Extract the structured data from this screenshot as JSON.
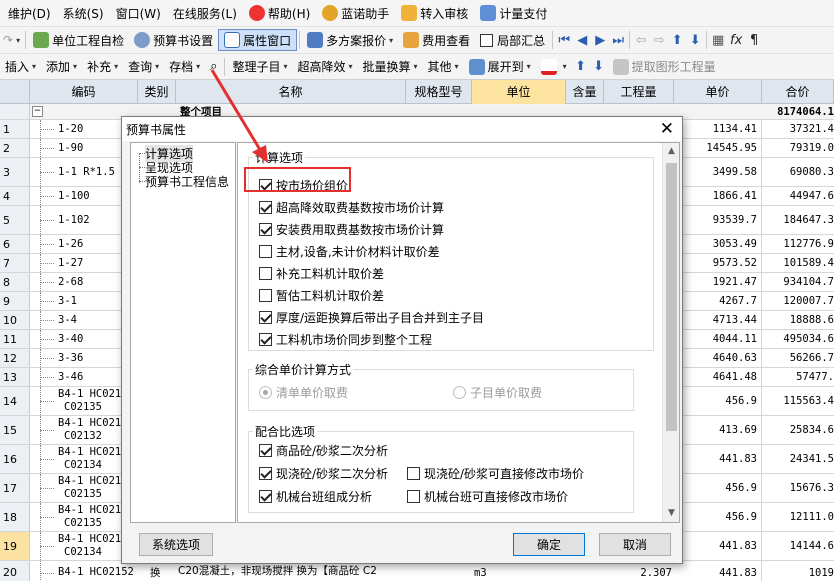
{
  "menubar": {
    "items": [
      "维护(D)",
      "系统(S)",
      "窗口(W)",
      "在线服务(L)",
      "帮助(H)",
      "蓝诺助手",
      "转入审核",
      "计量支付"
    ]
  },
  "toolbar1": {
    "items": [
      "单位工程自检",
      "预算书设置",
      "属性窗口",
      "多方案报价",
      "费用查看",
      "局部汇总"
    ]
  },
  "toolbar2": {
    "items": [
      "插入",
      "添加",
      "补充",
      "查询",
      "存档",
      "整理子目",
      "超高降效",
      "批量换算",
      "其他",
      "展开到",
      "提取图形工程量"
    ]
  },
  "grid": {
    "headers": [
      "编码",
      "类别",
      "名称",
      "规格型号",
      "单位",
      "含量",
      "工程量",
      "单价",
      "合价"
    ],
    "top_row": {
      "name": "整个项目",
      "total": "8174064.1"
    },
    "rows": [
      {
        "no": "1",
        "code": "1-20",
        "price": "1134.41",
        "total": "37321.4"
      },
      {
        "no": "2",
        "code": "1-90",
        "price": "14545.95",
        "total": "79319.0"
      },
      {
        "no": "3",
        "code": "1-1 R*1.5",
        "price": "3499.58",
        "total": "69080.3"
      },
      {
        "no": "4",
        "code": "1-100",
        "price": "1866.41",
        "total": "44947.6"
      },
      {
        "no": "5",
        "code": "1-102",
        "price": "93539.7",
        "total": "184647.3"
      },
      {
        "no": "6",
        "code": "1-26",
        "price": "3053.49",
        "total": "112776.9"
      },
      {
        "no": "7",
        "code": "1-27",
        "price": "9573.52",
        "total": "101589.4"
      },
      {
        "no": "8",
        "code": "2-68",
        "price": "1921.47",
        "total": "934104.7"
      },
      {
        "no": "9",
        "code": "3-1",
        "price": "4267.7",
        "total": "120007.7"
      },
      {
        "no": "10",
        "code": "3-4",
        "price": "4713.44",
        "total": "18888.6"
      },
      {
        "no": "11",
        "code": "3-40",
        "price": "4044.11",
        "total": "495034.6"
      },
      {
        "no": "12",
        "code": "3-36",
        "price": "4640.63",
        "total": "56266.7"
      },
      {
        "no": "13",
        "code": "3-46",
        "price": "4641.48",
        "total": "57477."
      },
      {
        "no": "14",
        "code": "B4-1 HC0215",
        "code2": "C02135",
        "price": "456.9",
        "total": "115563.4"
      },
      {
        "no": "15",
        "code": "B4-1 HC0215",
        "code2": "C02132",
        "price": "413.69",
        "total": "25834.6"
      },
      {
        "no": "16",
        "code": "B4-1 HC0215",
        "code2": "C02134",
        "price": "441.83",
        "total": "24341.5"
      },
      {
        "no": "17",
        "code": "B4-1 HC0215",
        "code2": "C02135",
        "price": "456.9",
        "total": "15676.3"
      },
      {
        "no": "18",
        "code": "B4-1 HC0215",
        "code2": "C02135",
        "price": "456.9",
        "total": "12111.0"
      },
      {
        "no": "19",
        "code": "B4-1 HC0215",
        "code2": "C02134",
        "price": "441.83",
        "total": "14144.6"
      },
      {
        "no": "20",
        "code": "B4-1 HC02152",
        "type": "换",
        "name": "C20混凝土，非现场搅拌 换为【商品砼 C2",
        "unit": "m3",
        "qty": "2.307",
        "price": "441.83",
        "total": "1019"
      }
    ]
  },
  "dialog": {
    "title": "预算书属性",
    "tree": [
      "计算选项",
      "呈现选项",
      "预算书工程信息"
    ],
    "group1": {
      "label": "计算选项",
      "options": [
        {
          "label": "按市场价组价",
          "checked": true
        },
        {
          "label": "超高降效取费基数按市场价计算",
          "checked": true
        },
        {
          "label": "安装费用取费基数按市场价计算",
          "checked": true
        },
        {
          "label": "主材,设备,未计价材料计取价差",
          "checked": false
        },
        {
          "label": "补充工料机计取价差",
          "checked": false
        },
        {
          "label": "暂估工料机计取价差",
          "checked": false
        },
        {
          "label": "厚度/运距换算后带出子目合并到主子目",
          "checked": true
        },
        {
          "label": "工料机市场价同步到整个工程",
          "checked": true
        }
      ]
    },
    "group2": {
      "label": "综合单价计算方式",
      "options": [
        {
          "label": "清单单价取费",
          "selected": true
        },
        {
          "label": "子目单价取费",
          "selected": false
        }
      ]
    },
    "group3": {
      "label": "配合比选项",
      "options": [
        {
          "label": "商品砼/砂浆二次分析",
          "checked": true
        },
        {
          "label": "现浇砼/砂浆二次分析",
          "checked": true
        },
        {
          "label": "现浇砼/砂浆可直接修改市场价",
          "checked": false
        },
        {
          "label": "机械台班组成分析",
          "checked": true
        },
        {
          "label": "机械台班可直接修改市场价",
          "checked": false
        }
      ]
    },
    "buttons": {
      "system": "系统选项",
      "ok": "确定",
      "cancel": "取消"
    }
  },
  "colors": {
    "annotation": "#e23030",
    "unit_header": "#fde3a0",
    "selected_row": "#fbe2a2",
    "header_bg": "#dfe6ee"
  }
}
